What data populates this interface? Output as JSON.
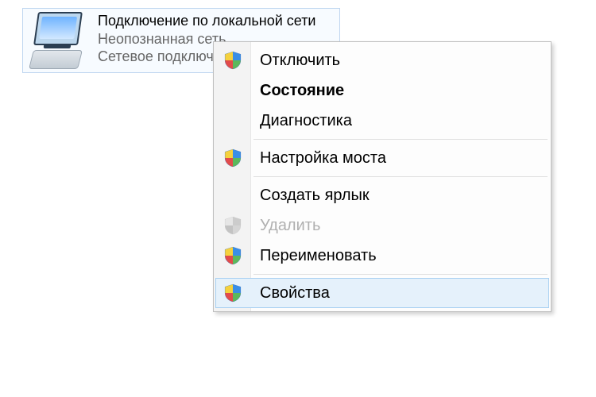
{
  "connection": {
    "title": "Подключение по локальной сети",
    "status": "Неопознанная сеть",
    "device": "Сетевое подключени"
  },
  "menu": {
    "items": [
      {
        "label": "Отключить",
        "shield": true,
        "bold": false,
        "disabled": false,
        "hover": false
      },
      {
        "label": "Состояние",
        "shield": false,
        "bold": true,
        "disabled": false,
        "hover": false
      },
      {
        "label": "Диагностика",
        "shield": false,
        "bold": false,
        "disabled": false,
        "hover": false
      },
      {
        "sep": true
      },
      {
        "label": "Настройка моста",
        "shield": true,
        "bold": false,
        "disabled": false,
        "hover": false
      },
      {
        "sep": true
      },
      {
        "label": "Создать ярлык",
        "shield": false,
        "bold": false,
        "disabled": false,
        "hover": false
      },
      {
        "label": "Удалить",
        "shield": true,
        "bold": false,
        "disabled": true,
        "hover": false
      },
      {
        "label": "Переименовать",
        "shield": true,
        "bold": false,
        "disabled": false,
        "hover": false
      },
      {
        "sep": true
      },
      {
        "label": "Свойства",
        "shield": true,
        "bold": false,
        "disabled": false,
        "hover": true
      }
    ]
  }
}
